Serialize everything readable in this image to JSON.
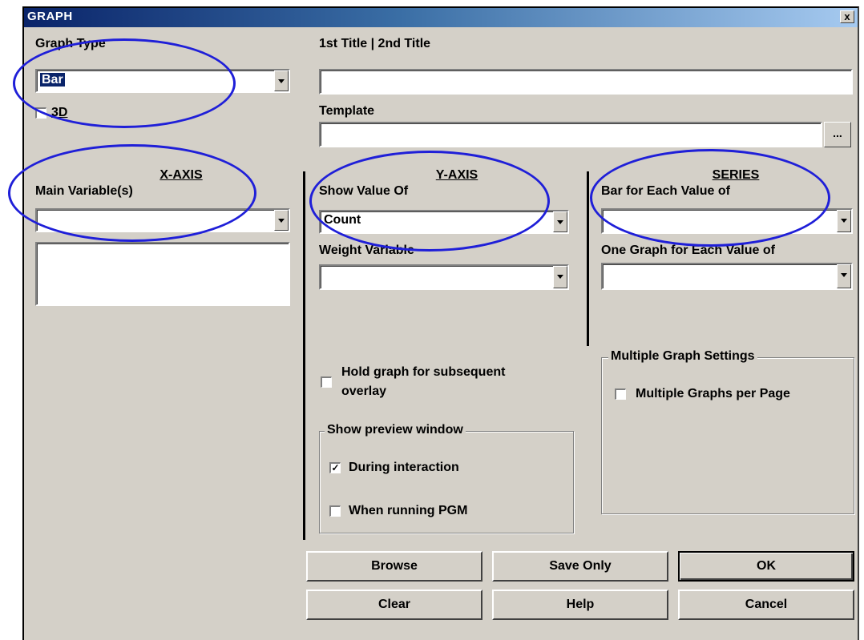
{
  "window": {
    "title": "GRAPH",
    "close_glyph": "x"
  },
  "graph_type": {
    "label": "Graph Type",
    "value": "Bar",
    "three_d_label": "3D",
    "three_d_checked": false
  },
  "titles": {
    "label": "1st Title | 2nd Title",
    "value": ""
  },
  "template": {
    "label": "Template",
    "value": "",
    "browse_glyph": "..."
  },
  "x_axis": {
    "header": "X-AXIS",
    "main_label": "Main Variable(s)",
    "main_value": "",
    "list_items": []
  },
  "y_axis": {
    "header": "Y-AXIS",
    "show_label": "Show Value Of",
    "show_value": "Count",
    "weight_label": "Weight Variable",
    "weight_value": ""
  },
  "series": {
    "header": "SERIES",
    "bar_label": "Bar for Each Value of",
    "bar_value": "",
    "graph_label": "One Graph for Each Value of",
    "graph_value": ""
  },
  "hold": {
    "label_line1": "Hold graph for subsequent",
    "label_line2": "overlay",
    "checked": false
  },
  "preview": {
    "title": "Show preview window",
    "during_label": "During interaction",
    "during_checked": true,
    "during_mark": "✓",
    "running_label": "When running PGM",
    "running_checked": false
  },
  "multi": {
    "title": "Multiple Graph Settings",
    "per_page_label": "Multiple Graphs per Page",
    "checked": false
  },
  "buttons": {
    "browse": "Browse",
    "save_only": "Save Only",
    "ok": "OK",
    "clear": "Clear",
    "help": "Help",
    "cancel": "Cancel"
  },
  "colors": {
    "annotation_ellipse": "#1f1fd8",
    "titlebar": "#0a246a",
    "dialog_bg": "#d4d0c8"
  }
}
